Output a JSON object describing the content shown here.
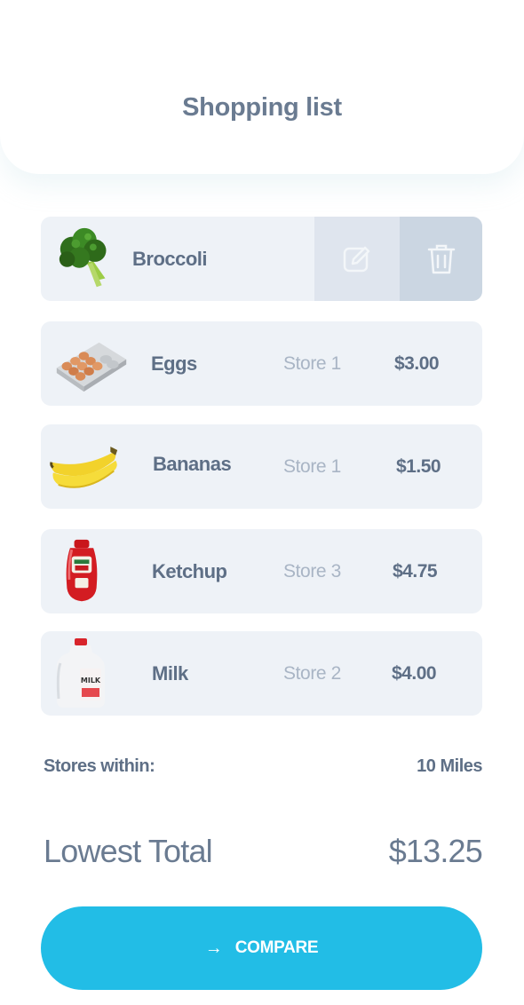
{
  "header": {
    "title": "Shopping list"
  },
  "items": [
    {
      "name": "Broccoli",
      "icon": "broccoli-image",
      "swiped": true
    },
    {
      "name": "Eggs",
      "store": "Store 1",
      "price": "$3.00",
      "icon": "eggs-image"
    },
    {
      "name": "Bananas",
      "store": "Store 1",
      "price": "$1.50",
      "icon": "bananas-image"
    },
    {
      "name": "Ketchup",
      "store": "Store 3",
      "price": "$4.75",
      "icon": "ketchup-image"
    },
    {
      "name": "Milk",
      "store": "Store 2",
      "price": "$4.00",
      "icon": "milk-image"
    }
  ],
  "actions": {
    "edit_icon": "edit-icon",
    "delete_icon": "trash-icon"
  },
  "radius": {
    "label": "Stores within:",
    "value": "10 Miles"
  },
  "total": {
    "label": "Lowest Total",
    "value": "$13.25"
  },
  "compare": {
    "label": "COMPARE",
    "icon": "arrow-right-icon"
  },
  "colors": {
    "accent": "#22bde6",
    "card": "#eef2f7",
    "text": "#5e6f86",
    "muted": "#a9b5c5"
  }
}
